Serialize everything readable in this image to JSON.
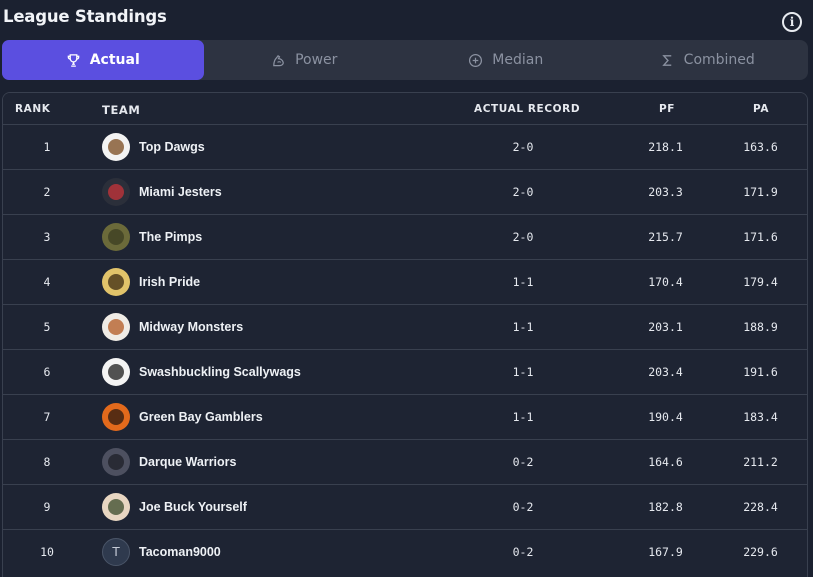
{
  "header": {
    "title": "League Standings",
    "info_icon": "info-icon"
  },
  "tabs": [
    {
      "label": "Actual",
      "icon": "trophy-icon",
      "active": true
    },
    {
      "label": "Power",
      "icon": "bicep-icon",
      "active": false
    },
    {
      "label": "Median",
      "icon": "plus-circle-icon",
      "active": false
    },
    {
      "label": "Combined",
      "icon": "sigma-icon",
      "active": false
    }
  ],
  "table": {
    "columns": [
      "RANK",
      "TEAM",
      "ACTUAL RECORD",
      "PF",
      "PA"
    ],
    "rows": [
      {
        "rank": "1",
        "team": "Top Dawgs",
        "record": "2-0",
        "pf": "218.1",
        "pa": "163.6",
        "avatar": "bulldog-logo",
        "avatar_bg": "#f3f3f3",
        "avatar_fg": "#7a4a1e"
      },
      {
        "rank": "2",
        "team": "Miami Jesters",
        "record": "2-0",
        "pf": "203.3",
        "pa": "171.9",
        "avatar": "helmet-logo",
        "avatar_bg": "#2b2f3a",
        "avatar_fg": "#c8343a"
      },
      {
        "rank": "3",
        "team": "The Pimps",
        "record": "2-0",
        "pf": "215.7",
        "pa": "171.6",
        "avatar": "photo-avatar",
        "avatar_bg": "#6b6a3a",
        "avatar_fg": "#3b3d22"
      },
      {
        "rank": "4",
        "team": "Irish Pride",
        "record": "1-1",
        "pf": "170.4",
        "pa": "179.4",
        "avatar": "leopard-logo",
        "avatar_bg": "#e1c36a",
        "avatar_fg": "#3b2a12"
      },
      {
        "rank": "5",
        "team": "Midway Monsters",
        "record": "1-1",
        "pf": "203.1",
        "pa": "188.9",
        "avatar": "claw-marks-logo",
        "avatar_bg": "#f0ece6",
        "avatar_fg": "#b35a22"
      },
      {
        "rank": "6",
        "team": "Swashbuckling Scallywags",
        "record": "1-1",
        "pf": "203.4",
        "pa": "191.6",
        "avatar": "pirate-logo",
        "avatar_bg": "#f4f4f4",
        "avatar_fg": "#1b1b1b"
      },
      {
        "rank": "7",
        "team": "Green Bay Gamblers",
        "record": "1-1",
        "pf": "190.4",
        "pa": "183.4",
        "avatar": "gamblers-logo",
        "avatar_bg": "#e36a1c",
        "avatar_fg": "#2a1a10"
      },
      {
        "rank": "8",
        "team": "Darque Warriors",
        "record": "0-2",
        "pf": "164.6",
        "pa": "211.2",
        "avatar": "wolf-logo",
        "avatar_bg": "#4d5060",
        "avatar_fg": "#1d1f27"
      },
      {
        "rank": "9",
        "team": "Joe Buck Yourself",
        "record": "0-2",
        "pf": "182.8",
        "pa": "228.4",
        "avatar": "cartoon-person-avatar",
        "avatar_bg": "#e8d6c2",
        "avatar_fg": "#3a4a2a"
      },
      {
        "rank": "10",
        "team": "Tacoman9000",
        "record": "0-2",
        "pf": "167.9",
        "pa": "229.6",
        "avatar": "letter-avatar",
        "avatar_letter": "T",
        "avatar_bg": "#2f3a4e",
        "avatar_fg": "#c6ccd8"
      }
    ]
  },
  "colors": {
    "accent": "#5b4fe0",
    "background": "#1b2130",
    "tab_bar": "#2d3341",
    "border": "#39404f"
  }
}
